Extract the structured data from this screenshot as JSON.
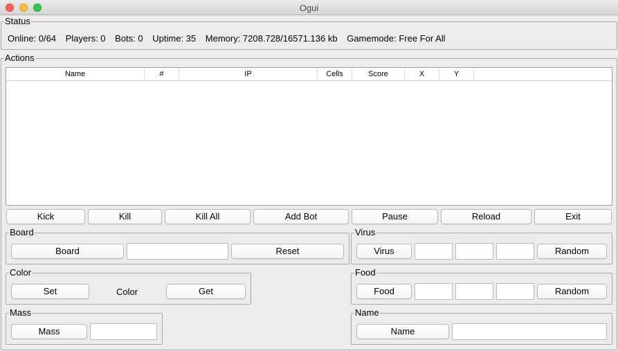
{
  "window": {
    "title": "Ogui"
  },
  "status": {
    "title": "Status",
    "online": "Online: 0/64",
    "players": "Players: 0",
    "bots": "Bots: 0",
    "uptime": "Uptime: 35",
    "memory": "Memory: 7208.728/16571.136 kb",
    "gamemode": "Gamemode: Free For All"
  },
  "actions": {
    "title": "Actions",
    "columns": [
      "Name",
      "#",
      "IP",
      "Cells",
      "Score",
      "X",
      "Y"
    ],
    "buttons": {
      "kick": "Kick",
      "kill": "Kill",
      "kill_all": "Kill All",
      "add_bot": "Add Bot",
      "pause": "Pause",
      "reload": "Reload",
      "exit": "Exit"
    }
  },
  "board": {
    "title": "Board",
    "button": "Board",
    "value": "",
    "reset": "Reset"
  },
  "color": {
    "title": "Color",
    "set": "Set",
    "label": "Color",
    "get": "Get"
  },
  "mass": {
    "title": "Mass",
    "button": "Mass",
    "value": ""
  },
  "virus": {
    "title": "Virus",
    "button": "Virus",
    "x": "",
    "y": "",
    "z": "",
    "random": "Random"
  },
  "food": {
    "title": "Food",
    "button": "Food",
    "x": "",
    "y": "",
    "z": "",
    "random": "Random"
  },
  "name": {
    "title": "Name",
    "button": "Name",
    "value": ""
  }
}
